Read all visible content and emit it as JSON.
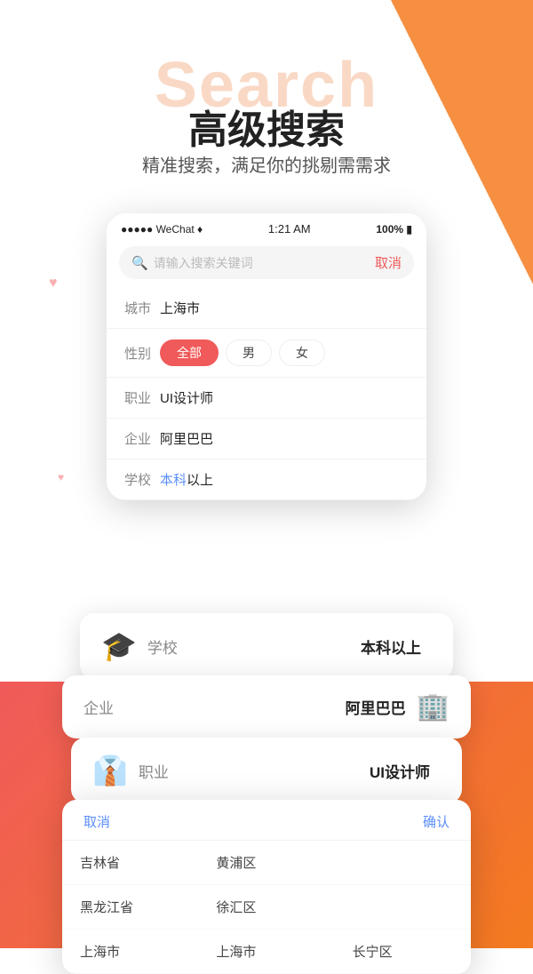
{
  "page": {
    "bg_color": "#ffffff",
    "orange_accent": "#f47b20",
    "red_accent": "#f05a5a"
  },
  "watermark": {
    "text": "Search"
  },
  "header": {
    "title": "高级搜索",
    "subtitle": "精准搜索，满足你的挑剔需需求"
  },
  "status_bar": {
    "left": "●●●●● WeChat ♦",
    "center": "1:21 AM",
    "right": "100% ▮"
  },
  "search_bar": {
    "placeholder": "请输入搜索关键词",
    "cancel_label": "取消"
  },
  "filters": [
    {
      "label": "城市",
      "value": "上海市",
      "type": "text"
    },
    {
      "label": "性别",
      "value": "",
      "type": "gender",
      "options": [
        "全部",
        "男",
        "女"
      ],
      "active": "全部"
    },
    {
      "label": "职业",
      "value": "UI设计师",
      "type": "text"
    },
    {
      "label": "企业",
      "value": "阿里巴巴",
      "type": "text"
    },
    {
      "label": "学校",
      "value": "本科以上",
      "type": "text"
    }
  ],
  "float_cards": {
    "school": {
      "icon": "🎓",
      "label": "学校",
      "value": "本科以上"
    },
    "company": {
      "icon": "🏢",
      "label": "企业",
      "value": "阿里巴巴"
    },
    "job": {
      "icon": "👔",
      "label": "职业",
      "value": "UI设计师"
    }
  },
  "bottom_panel": {
    "cancel_label": "取消",
    "confirm_label": "确认",
    "items": [
      [
        "吉林省",
        "黄浦区",
        ""
      ],
      [
        "黑龙江省",
        "徐汇区",
        ""
      ],
      [
        "上海市",
        "上海市",
        "长宁区"
      ]
    ]
  }
}
